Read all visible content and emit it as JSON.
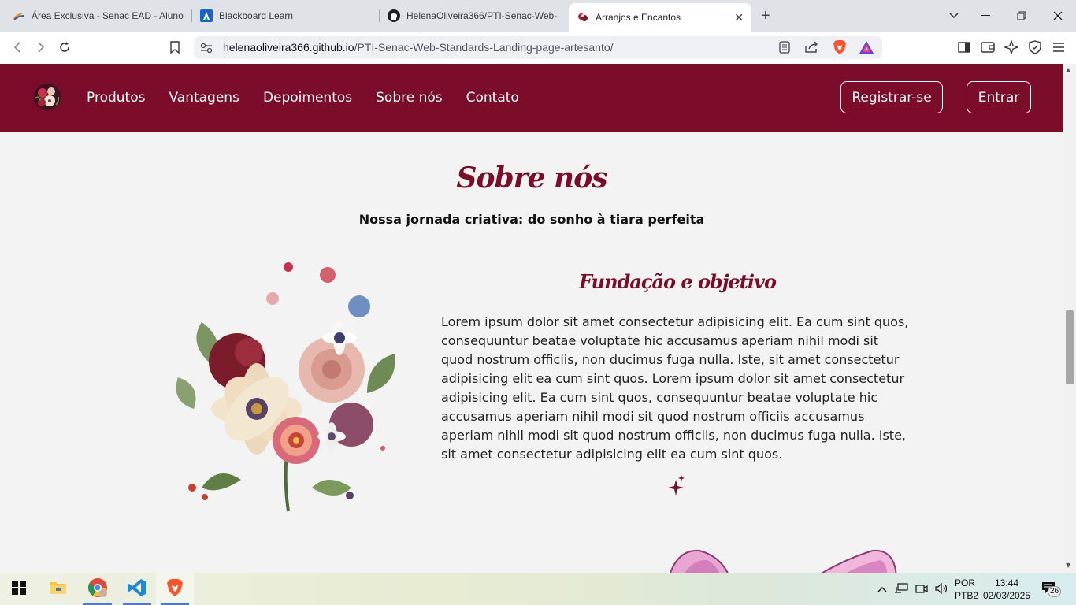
{
  "browser": {
    "tabs": [
      {
        "title": "Área Exclusiva - Senac EAD - Aluno",
        "icon": "senac-icon",
        "active": false
      },
      {
        "title": "Blackboard Learn",
        "icon": "blackboard-icon",
        "active": false
      },
      {
        "title": "HelenaOliveira366/PTI-Senac-Web-",
        "icon": "github-icon",
        "active": false
      },
      {
        "title": "Arranjos e Encantos",
        "icon": "flower-icon",
        "active": true
      }
    ],
    "new_tab_symbol": "+",
    "url_domain": "helenaoliveira366.github.io",
    "url_path": "/PTI-Senac-Web-Standards-Landing-page-artesanto/"
  },
  "site": {
    "nav": [
      "Produtos",
      "Vantagens",
      "Depoimentos",
      "Sobre nós",
      "Contato"
    ],
    "register_label": "Registrar-se",
    "login_label": "Entrar",
    "brand_color": "#7b0c2a",
    "section_title": "Sobre nós",
    "section_subtitle": "Nossa jornada criativa: do sonho à tiara perfeita",
    "block_title": "Fundação e objetivo",
    "block_text": "Lorem ipsum dolor sit amet consectetur adipisicing elit. Ea cum sint quos, consequuntur beatae voluptate hic accusamus aperiam nihil modi sit quod nostrum officiis, non ducimus fuga nulla. Iste, sit amet consectetur adipisicing elit ea cum sint quos. Lorem ipsum dolor sit amet consectetur adipisicing elit. Ea cum sint quos, consequuntur beatae voluptate hic accusamus aperiam nihil modi sit quod nostrum officiis accusamus aperiam nihil modi sit quod nostrum officiis, non ducimus fuga nulla. Iste, sit amet consectetur adipisicing elit ea cum sint quos."
  },
  "taskbar": {
    "apps": [
      "start-icon",
      "file-explorer-icon",
      "chrome-icon",
      "vscode-icon",
      "brave-icon"
    ],
    "lang_top": "POR",
    "lang_bottom": "PTB2",
    "time": "13:44",
    "date": "02/03/2025",
    "notifications": "26"
  }
}
